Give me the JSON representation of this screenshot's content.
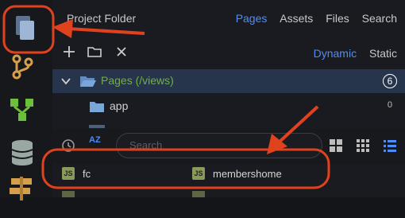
{
  "header": {
    "title": "Project Folder",
    "tabs": [
      "Pages",
      "Assets",
      "Files",
      "Search"
    ],
    "active_tab": "Pages"
  },
  "toolbar": {
    "modes": [
      "Dynamic",
      "Static"
    ],
    "active_mode": "Dynamic"
  },
  "tree": {
    "root": {
      "label": "Pages (/views)",
      "badge": "6"
    },
    "children": [
      {
        "label": "app",
        "count": "0"
      }
    ]
  },
  "filter": {
    "sort_label": "AZ",
    "search_placeholder": "Search"
  },
  "files": [
    {
      "icon_text": "JS",
      "name": "fc"
    },
    {
      "icon_text": "JS",
      "name": "membershome"
    }
  ],
  "colors": {
    "accent": "#4f8df5",
    "annotation": "#e0421e",
    "folder": "#7aa7d8",
    "selected_row": "#26344c"
  }
}
